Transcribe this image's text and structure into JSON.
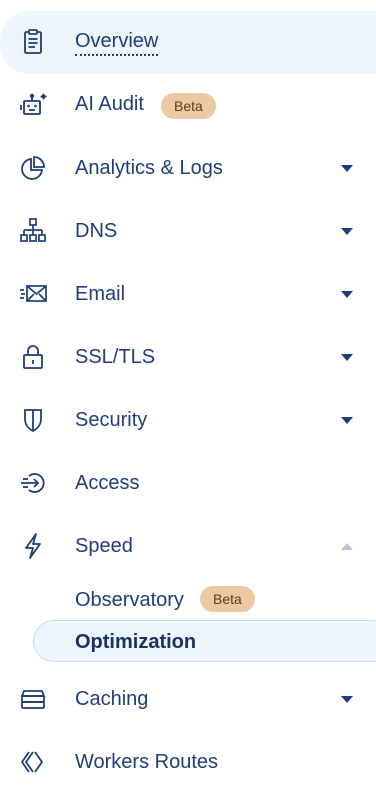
{
  "nav": {
    "overview": "Overview",
    "ai_audit": "AI Audit",
    "ai_audit_badge": "Beta",
    "analytics": "Analytics & Logs",
    "dns": "DNS",
    "email": "Email",
    "ssl": "SSL/TLS",
    "security": "Security",
    "access": "Access",
    "speed": "Speed",
    "speed_sub": {
      "observatory": "Observatory",
      "observatory_badge": "Beta",
      "optimization": "Optimization"
    },
    "caching": "Caching",
    "workers": "Workers Routes"
  },
  "colors": {
    "text": "#1f3d7a",
    "active_bg": "#eef5fd",
    "badge_bg": "#ecc9a3"
  },
  "icons": [
    "clipboard-icon",
    "robot-icon",
    "pie-chart-icon",
    "sitemap-icon",
    "mail-icon",
    "lock-icon",
    "shield-icon",
    "login-arrow-icon",
    "lightning-icon",
    "server-stack-icon",
    "chevrons-icon"
  ]
}
